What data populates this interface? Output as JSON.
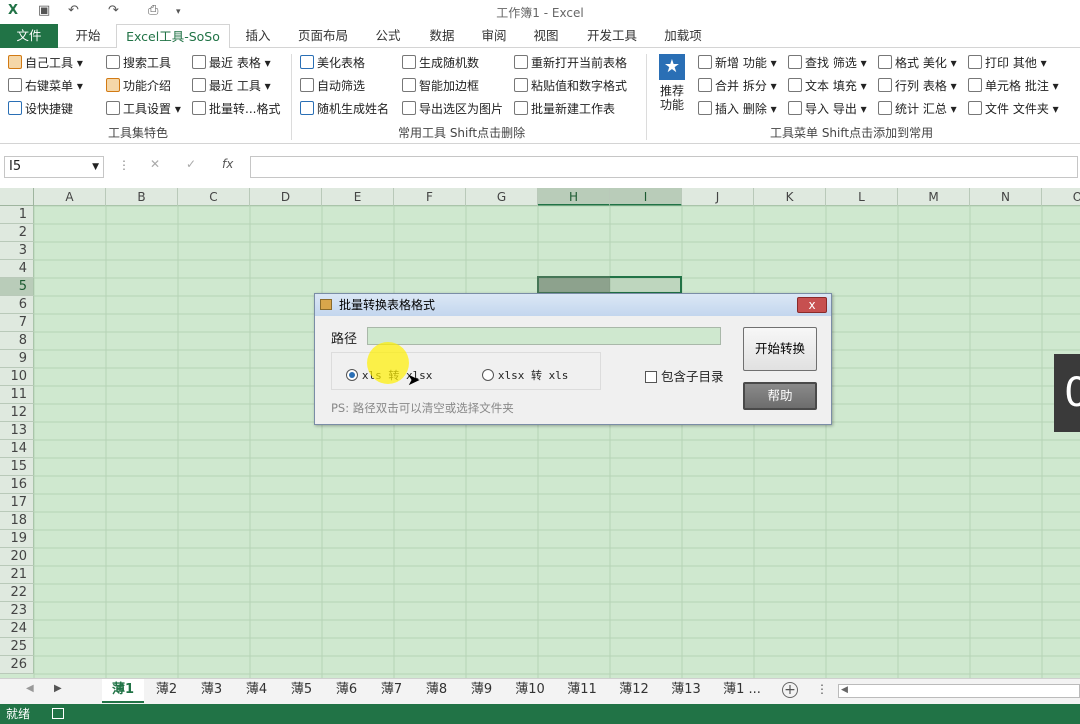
{
  "app": {
    "title": "工作簿1 - Excel"
  },
  "ribbon_tabs": [
    "文件",
    "开始",
    "Excel工具-SoSo",
    "插入",
    "页面布局",
    "公式",
    "数据",
    "审阅",
    "视图",
    "开发工具",
    "加载项"
  ],
  "ribbon": {
    "g1": [
      "自己工具",
      "右键菜单",
      "设快捷键"
    ],
    "g2": [
      "搜索工具",
      "功能介绍",
      "工具设置"
    ],
    "g3": [
      "最近 表格",
      "最近 工具",
      "批量转...格式"
    ],
    "group1_label": "工具集特色",
    "g4": [
      "美化表格",
      "自动筛选",
      "随机生成姓名"
    ],
    "g5": [
      "生成随机数",
      "智能加边框",
      "导出选区为图片"
    ],
    "g6": [
      "重新打开当前表格",
      "粘贴值和数字格式",
      "批量新建工作表"
    ],
    "group2_label": "常用工具 Shift点击删除",
    "recommend": "推荐\n功能",
    "g7": [
      "新增 功能",
      "合并 拆分",
      "插入 删除"
    ],
    "g8": [
      "查找 筛选",
      "文本 填充",
      "导入 导出"
    ],
    "g9": [
      "格式 美化",
      "行列 表格",
      "统计 汇总"
    ],
    "g10": [
      "打印 其他",
      "单元格 批注",
      "文件 文件夹"
    ],
    "group3_label": "工具菜单 Shift点击添加到常用"
  },
  "formula_bar": {
    "name_box": "I5",
    "fx": "fx",
    "cancel": "✕",
    "enter": "✓"
  },
  "columns": [
    "A",
    "B",
    "C",
    "D",
    "E",
    "F",
    "G",
    "H",
    "I",
    "J",
    "K",
    "L",
    "M",
    "N",
    "O"
  ],
  "rows": [
    "1",
    "2",
    "3",
    "4",
    "5",
    "6",
    "7",
    "8",
    "9",
    "10",
    "11",
    "12",
    "13",
    "14",
    "15",
    "16",
    "17",
    "18",
    "19",
    "20",
    "21",
    "22",
    "23",
    "24",
    "25",
    "26"
  ],
  "dialog": {
    "title": "批量转换表格格式",
    "path_label": "路径",
    "path_value": "",
    "radio1": "xls 转 xlsx",
    "radio2": "xlsx 转 xls",
    "include_sub": "包含子目录",
    "hint": "PS: 路径双击可以清空或选择文件夹",
    "start_button": "开始转换",
    "help_button": "帮助",
    "radio1_selected": true,
    "close": "x"
  },
  "sheets": [
    "薄1",
    "薄2",
    "薄3",
    "薄4",
    "薄5",
    "薄6",
    "薄7",
    "薄8",
    "薄9",
    "薄10",
    "薄11",
    "薄12",
    "薄13",
    "薄1 ..."
  ],
  "status": {
    "ready": "就绪"
  },
  "colors": {
    "excel_green": "#217346",
    "grid_bg": "#cfe8cf"
  }
}
